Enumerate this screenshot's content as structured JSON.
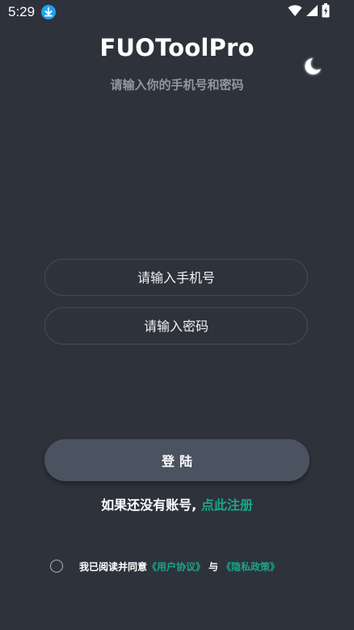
{
  "status_bar": {
    "time": "5:29",
    "icons": [
      "download-icon",
      "wifi-icon",
      "signal-icon",
      "battery-charging-icon"
    ]
  },
  "header": {
    "title": "FUOToolPro",
    "subtitle": "请输入你的手机号和密码",
    "theme_icon": "moon-icon"
  },
  "form": {
    "phone_placeholder": "请输入手机号",
    "phone_value": "",
    "password_placeholder": "请输入密码",
    "password_value": "",
    "login_label": "登陆"
  },
  "register": {
    "prompt": "如果还没有账号,",
    "link": "点此注册"
  },
  "agreement": {
    "checked": false,
    "text": "我已阅读并同意",
    "user_agreement": "《用户协议》",
    "separator": "与",
    "privacy_policy": "《隐私政策》"
  },
  "colors": {
    "background": "#2e323b",
    "accent": "#1aa58a",
    "button": "#4b5260",
    "subtitle": "#9097a3"
  }
}
